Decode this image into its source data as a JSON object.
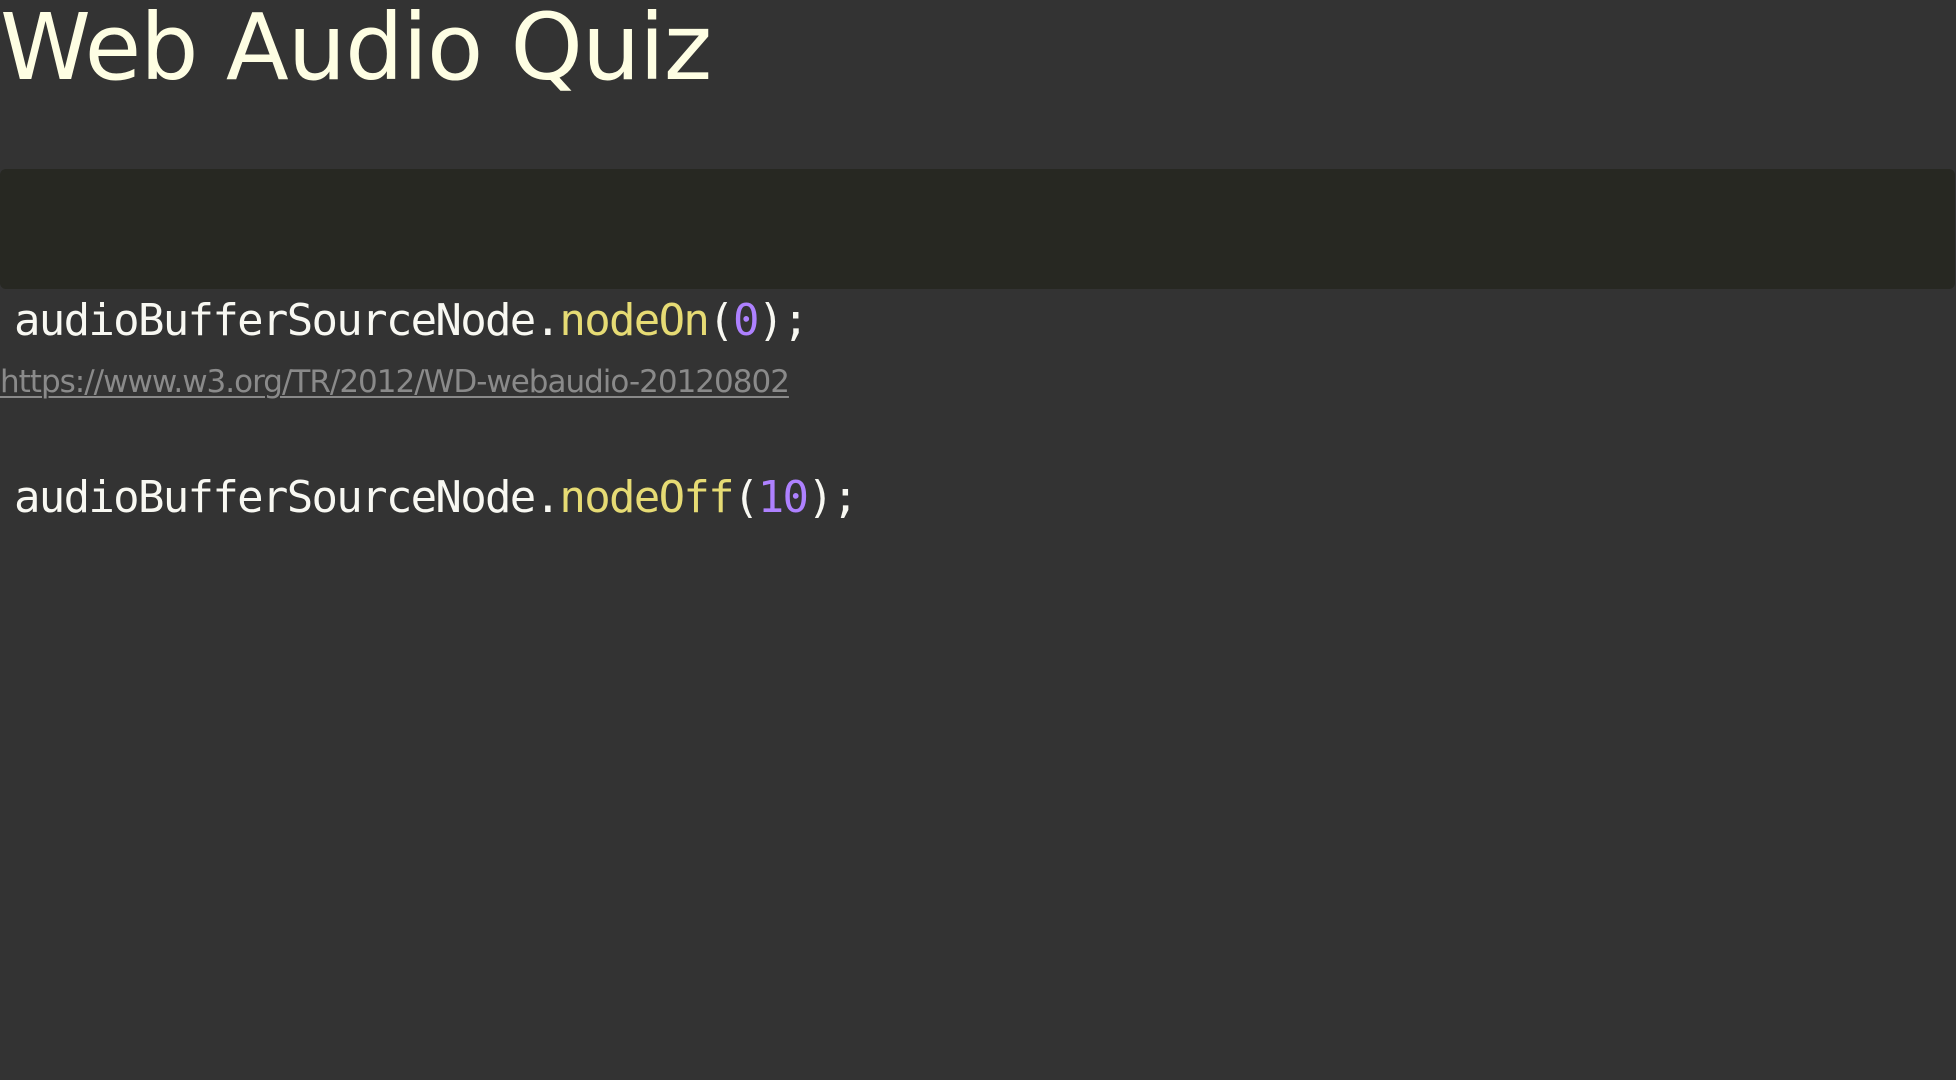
{
  "slide": {
    "title": "Web Audio Quiz"
  },
  "code": {
    "lines": [
      {
        "object": "audioBufferSourceNode",
        "dot": ".",
        "method": "nodeOn",
        "open_paren": "(",
        "arg": "0",
        "close": ");"
      },
      {
        "object": "audioBufferSourceNode",
        "dot": ".",
        "method": "nodeOff",
        "open_paren": "(",
        "arg": "10",
        "close": ");"
      }
    ]
  },
  "reference": {
    "link_text": "https://www.w3.org/TR/2012/WD-webaudio-20120802"
  },
  "colors": {
    "background": "#333333",
    "code_background": "#272822",
    "title": "#fefee3",
    "method": "#e6db74",
    "number": "#ae81ff",
    "link": "#8a8a8a"
  }
}
